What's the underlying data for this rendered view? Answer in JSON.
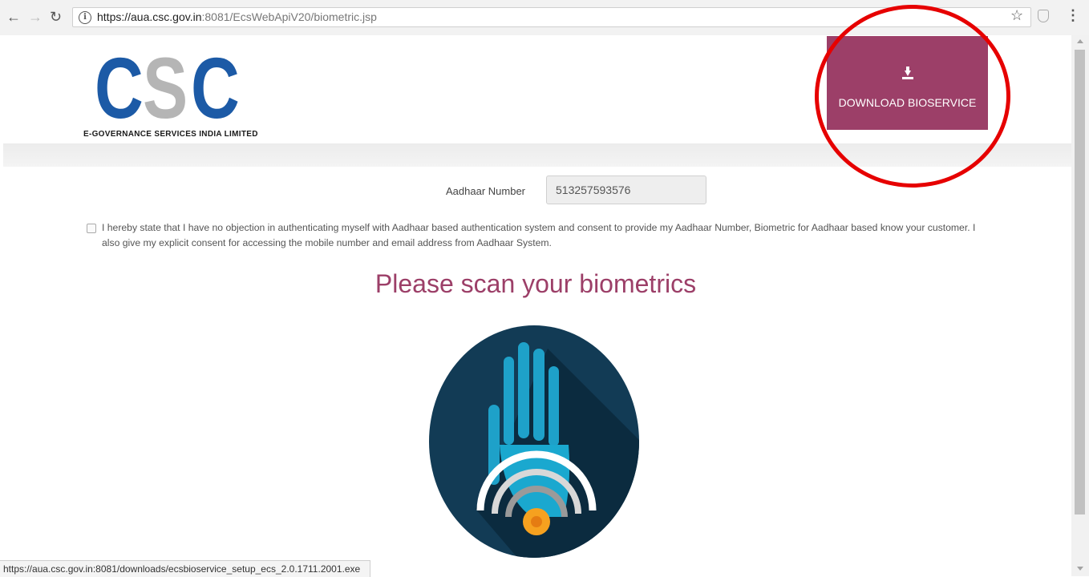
{
  "browser": {
    "url_domain": "https://aua.csc.gov.in",
    "url_path": ":8081/EcsWebApiV20/biometric.jsp",
    "status_url": "https://aua.csc.gov.in:8081/downloads/ecsbioservice_setup_ecs_2.0.1711.2001.exe"
  },
  "logo": {
    "letters": [
      "C",
      "S",
      "C"
    ],
    "tagline": "E-GOVERNANCE SERVICES INDIA LIMITED",
    "colors": {
      "blue": "#1c5aa6",
      "grey": "#b5b5b5"
    }
  },
  "download": {
    "label": "DOWNLOAD BIOSERVICE",
    "icon": "download-icon",
    "color": "#9c3f68"
  },
  "form": {
    "aadhaar_label": "Aadhaar Number",
    "aadhaar_value": "513257593576",
    "consent_text": "I hereby state that I have no objection in authenticating myself with Aadhaar based authentication system and consent to provide my Aadhaar Number, Biometric for Aadhaar based know your customer. I also give my explicit consent for accessing the mobile number and email address from Aadhaar System.",
    "consent_checked": false
  },
  "main": {
    "heading": "Please scan your biometrics"
  },
  "colors": {
    "accent": "#9c3f68",
    "annotation_circle": "#e60000"
  }
}
